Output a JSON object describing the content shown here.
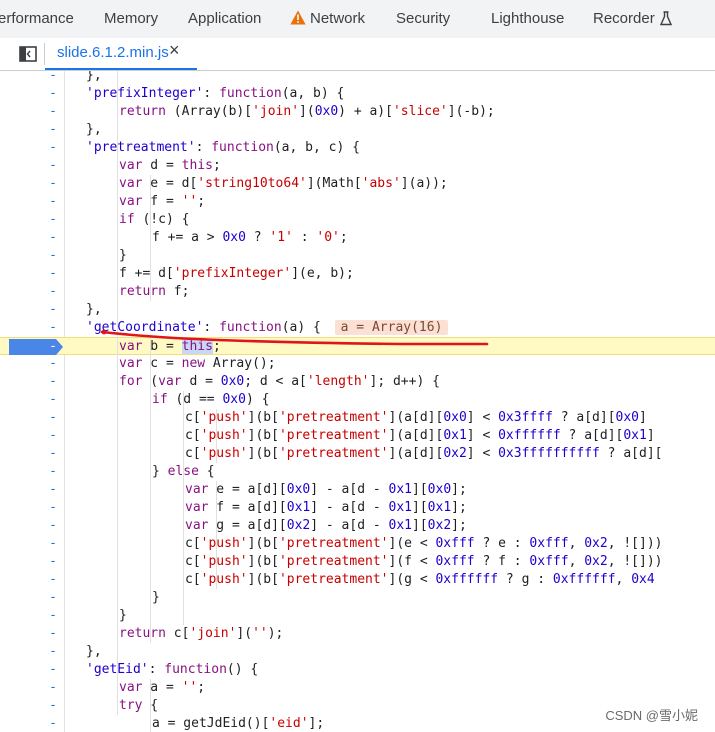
{
  "devtools_tabs": [
    {
      "label": "erformance",
      "icon": null
    },
    {
      "label": "Memory",
      "icon": null
    },
    {
      "label": "Application",
      "icon": null
    },
    {
      "label": "Network",
      "icon": "warning-icon"
    },
    {
      "label": "Security",
      "icon": null
    },
    {
      "label": "Lighthouse",
      "icon": null
    },
    {
      "label": "Recorder",
      "icon": "flask-icon"
    }
  ],
  "file_tab": {
    "name": "slide.6.1.2.min.js",
    "close_glyph": "×"
  },
  "gutter_marker": "-",
  "code_lines": [
    {
      "indent": 1,
      "html": "},"
    },
    {
      "indent": 1,
      "html": "<span class='pn'>'prefixInteger'</span>: <span class='k'>function</span>(a, b) {"
    },
    {
      "indent": 2,
      "html": "<span class='k'>return</span> (Array(b)[<span class='s'>'join'</span>](<span class='n'>0x0</span>) + a)[<span class='s'>'slice'</span>](-b);"
    },
    {
      "indent": 1,
      "html": "},"
    },
    {
      "indent": 1,
      "html": "<span class='pn'>'pretreatment'</span>: <span class='k'>function</span>(a, b, c) {"
    },
    {
      "indent": 2,
      "html": "<span class='k'>var</span> d = <span class='k'>this</span>;"
    },
    {
      "indent": 2,
      "html": "<span class='k'>var</span> e = d[<span class='s'>'string10to64'</span>](Math[<span class='s'>'abs'</span>](a));"
    },
    {
      "indent": 2,
      "html": "<span class='k'>var</span> f = <span class='s'>''</span>;"
    },
    {
      "indent": 2,
      "html": "<span class='k'>if</span> (!c) {"
    },
    {
      "indent": 3,
      "html": "f += a &gt; <span class='n'>0x0</span> ? <span class='s'>'1'</span> : <span class='s'>'0'</span>;"
    },
    {
      "indent": 2,
      "html": "}"
    },
    {
      "indent": 2,
      "html": "f += d[<span class='s'>'prefixInteger'</span>](e, b);"
    },
    {
      "indent": 2,
      "html": "<span class='k'>return</span> f;"
    },
    {
      "indent": 1,
      "html": "},"
    },
    {
      "indent": 1,
      "html": "<span class='pn'>'getCoordinate'</span>: <span class='k'>function</span>(a) {",
      "inline_value": "a = Array(16)"
    },
    {
      "indent": 2,
      "html": "<span class='k'>var</span> b = <span class='sel'><span class='k'>this</span></span>;",
      "paused": true
    },
    {
      "indent": 2,
      "html": "<span class='k'>var</span> c = <span class='k'>new</span> Array();"
    },
    {
      "indent": 2,
      "html": "<span class='k'>for</span> (<span class='k'>var</span> d = <span class='n'>0x0</span>; d &lt; a[<span class='s'>'length'</span>]; d++) {"
    },
    {
      "indent": 3,
      "html": "<span class='k'>if</span> (d == <span class='n'>0x0</span>) {"
    },
    {
      "indent": 4,
      "html": "c[<span class='s'>'push'</span>](b[<span class='s'>'pretreatment'</span>](a[d][<span class='n'>0x0</span>] &lt; <span class='n'>0x3ffff</span> ? a[d][<span class='n'>0x0</span>]"
    },
    {
      "indent": 4,
      "html": "c[<span class='s'>'push'</span>](b[<span class='s'>'pretreatment'</span>](a[d][<span class='n'>0x1</span>] &lt; <span class='n'>0xffffff</span> ? a[d][<span class='n'>0x1</span>]"
    },
    {
      "indent": 4,
      "html": "c[<span class='s'>'push'</span>](b[<span class='s'>'pretreatment'</span>](a[d][<span class='n'>0x2</span>] &lt; <span class='n'>0x3ffffffffff</span> ? a[d]["
    },
    {
      "indent": 3,
      "html": "} <span class='k'>else</span> {"
    },
    {
      "indent": 4,
      "html": "<span class='k'>var</span> e = a[d][<span class='n'>0x0</span>] - a[d - <span class='n'>0x1</span>][<span class='n'>0x0</span>];"
    },
    {
      "indent": 4,
      "html": "<span class='k'>var</span> f = a[d][<span class='n'>0x1</span>] - a[d - <span class='n'>0x1</span>][<span class='n'>0x1</span>];"
    },
    {
      "indent": 4,
      "html": "<span class='k'>var</span> g = a[d][<span class='n'>0x2</span>] - a[d - <span class='n'>0x1</span>][<span class='n'>0x2</span>];"
    },
    {
      "indent": 4,
      "html": "c[<span class='s'>'push'</span>](b[<span class='s'>'pretreatment'</span>](e &lt; <span class='n'>0xfff</span> ? e : <span class='n'>0xfff</span>, <span class='n'>0x2</span>, ![]))"
    },
    {
      "indent": 4,
      "html": "c[<span class='s'>'push'</span>](b[<span class='s'>'pretreatment'</span>](f &lt; <span class='n'>0xfff</span> ? f : <span class='n'>0xfff</span>, <span class='n'>0x2</span>, ![]))"
    },
    {
      "indent": 4,
      "html": "c[<span class='s'>'push'</span>](b[<span class='s'>'pretreatment'</span>](g &lt; <span class='n'>0xffffff</span> ? g : <span class='n'>0xffffff</span>, <span class='n'>0x4</span>"
    },
    {
      "indent": 3,
      "html": "}"
    },
    {
      "indent": 2,
      "html": "}"
    },
    {
      "indent": 2,
      "html": "<span class='k'>return</span> c[<span class='s'>'join'</span>](<span class='s'>''</span>);"
    },
    {
      "indent": 1,
      "html": "},"
    },
    {
      "indent": 1,
      "html": "<span class='pn'>'getEid'</span>: <span class='k'>function</span>() {"
    },
    {
      "indent": 2,
      "html": "<span class='k'>var</span> a = <span class='s'>''</span>;"
    },
    {
      "indent": 2,
      "html": "<span class='k'>try</span> {"
    },
    {
      "indent": 3,
      "html": "a = getJdEid()[<span class='s'>'eid'</span>];"
    }
  ],
  "watermark": "CSDN @雪小妮",
  "colors": {
    "keyword": "#881280",
    "string": "#c80000",
    "number": "#1c00cf",
    "link": "#1a73e8",
    "paused_line": "#fff9c4",
    "annotation": "#e0151b"
  }
}
